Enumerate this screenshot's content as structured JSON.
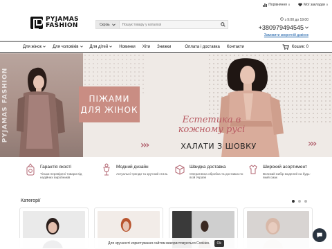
{
  "topbar": {
    "compare_label": "Порівняння",
    "compare_count": "0",
    "wishlist_label": "Мої закладки",
    "wishlist_count": "0"
  },
  "header": {
    "logo_line1": "PYJAMAS",
    "logo_line2": "FASHION",
    "search_scope": "Скрізь",
    "search_placeholder": "Пошук товару у каталозі",
    "hours": "з 9:00 до 19:00",
    "phone": "+380979494545",
    "callback": "Замовити зворотній дзвінок"
  },
  "nav": {
    "items": [
      "Для жінок",
      "Для чоловіків",
      "Для дітей",
      "Новинки",
      "Хіти",
      "Знижки"
    ],
    "items2": [
      "Оплата і доставка",
      "Контакти"
    ],
    "cart_label": "Кошик: 0"
  },
  "banner": {
    "brand": "PYJAMAS FASHION",
    "box_line1": "ПІЖАМИ",
    "box_line2": "ДЛЯ ЖІНОК",
    "slogan_line1": "Естетика в",
    "slogan_line2": "кожному русі",
    "title": "ХАЛАТИ З ШОВКУ",
    "chevrons": "›››"
  },
  "features": [
    {
      "title": "Гарантія якості",
      "desc": "Тільки перевірені товари від надійних виробників",
      "icon": "quality-icon"
    },
    {
      "title": "Модний дизайн",
      "desc": "Актуальні тренди та зручний стиль",
      "icon": "design-icon"
    },
    {
      "title": "Швидка доставка",
      "desc": "Оперативна обробка та доставка по всій Україні",
      "icon": "delivery-icon"
    },
    {
      "title": "Широкий асортимент",
      "desc": "Великий вибір моделей на будь-який смак",
      "icon": "assortment-icon"
    }
  ],
  "categories": {
    "title": "Категорії"
  },
  "cookie": {
    "text": "Для зручності користування сайтом використовуються Cookies.",
    "ok": "Ok"
  },
  "colors": {
    "accent": "#c98d83",
    "banner_text": "#b85a62",
    "dark": "#2a3440"
  }
}
